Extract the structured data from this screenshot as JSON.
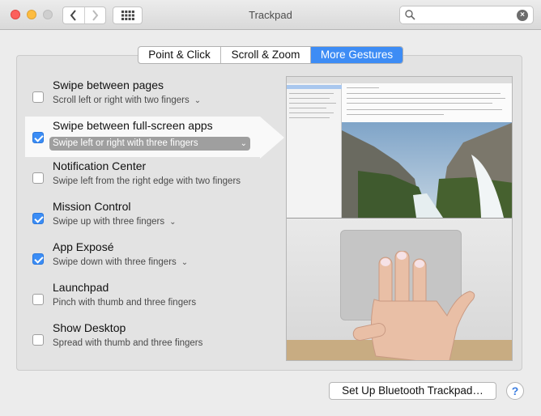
{
  "window": {
    "title": "Trackpad",
    "search_placeholder": "",
    "search_clear_glyph": "×"
  },
  "tabs": [
    {
      "label": "Point & Click",
      "active": false
    },
    {
      "label": "Scroll & Zoom",
      "active": false
    },
    {
      "label": "More Gestures",
      "active": true
    }
  ],
  "gestures": [
    {
      "title": "Swipe between pages",
      "subtitle": "Scroll left or right with two fingers",
      "checked": false,
      "has_menu": true,
      "selected": false
    },
    {
      "title": "Swipe between full-screen apps",
      "subtitle": "Swipe left or right with three fingers",
      "checked": true,
      "has_menu": true,
      "selected": true
    },
    {
      "title": "Notification Center",
      "subtitle": "Swipe left from the right edge with two fingers",
      "checked": false,
      "has_menu": false,
      "selected": false
    },
    {
      "title": "Mission Control",
      "subtitle": "Swipe up with three fingers",
      "checked": true,
      "has_menu": true,
      "selected": false
    },
    {
      "title": "App Exposé",
      "subtitle": "Swipe down with three fingers",
      "checked": true,
      "has_menu": true,
      "selected": false
    },
    {
      "title": "Launchpad",
      "subtitle": "Pinch with thumb and three fingers",
      "checked": false,
      "has_menu": false,
      "selected": false
    },
    {
      "title": "Show Desktop",
      "subtitle": "Spread with thumb and three fingers",
      "checked": false,
      "has_menu": false,
      "selected": false
    }
  ],
  "bottom": {
    "bluetooth_label": "Set Up Bluetooth Trackpad…",
    "help_label": "?"
  },
  "colors": {
    "accent": "#3d8cf5",
    "checkbox_checked": "#3b8df5",
    "close": "#fc605c",
    "minimize": "#fdbc40"
  },
  "icons": {
    "back": "chevron-left-icon",
    "forward": "chevron-right-icon",
    "grid": "grid-icon",
    "search": "search-icon",
    "clear": "clear-icon",
    "menu": "chevron-down-icon"
  }
}
